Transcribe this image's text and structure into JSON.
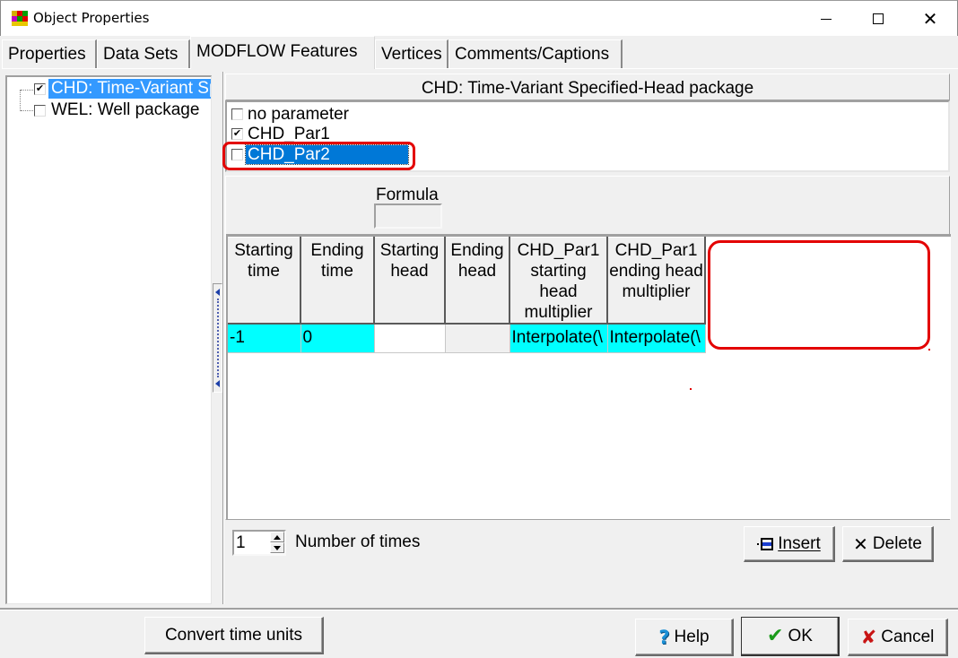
{
  "window": {
    "title": "Object Properties",
    "controls": {
      "minimize": "minimize",
      "maximize": "maximize",
      "close": "close"
    }
  },
  "tabs": [
    {
      "label": "Properties",
      "active": false
    },
    {
      "label": "Data Sets",
      "active": false
    },
    {
      "label": "MODFLOW Features",
      "active": true
    },
    {
      "label": "Vertices",
      "active": false
    },
    {
      "label": "Comments/Captions",
      "active": false
    }
  ],
  "tree": {
    "items": [
      {
        "label": "CHD: Time-Variant Specified-Head package",
        "checked": true,
        "selected": true
      },
      {
        "label": "WEL: Well package",
        "checked": false,
        "selected": false
      }
    ]
  },
  "package": {
    "header": "CHD: Time-Variant Specified-Head package",
    "parameters": [
      {
        "label": "no parameter",
        "checked": false,
        "selected": false
      },
      {
        "label": "CHD_Par1",
        "checked": true,
        "selected": false
      },
      {
        "label": "CHD_Par2",
        "checked": false,
        "selected": true
      }
    ]
  },
  "formula": {
    "label": "Formula",
    "value": ""
  },
  "grid": {
    "columns": [
      "Starting time",
      "Ending time",
      "Starting head",
      "Ending head",
      "CHD_Par1 starting head multiplier",
      "CHD_Par1 ending head multiplier"
    ],
    "rows": [
      [
        "-1",
        "0",
        "",
        "",
        "Interpolate(\\",
        "Interpolate(\\"
      ]
    ]
  },
  "number_of_times": {
    "label": "Number of times",
    "value": "1"
  },
  "buttons": {
    "insert": "Insert",
    "delete": "Delete",
    "convert": "Convert time units",
    "help": "Help",
    "ok": "OK",
    "cancel": "Cancel"
  },
  "icons": {
    "app": "modelmuse-app-icon",
    "insert": "insert-row-icon",
    "delete": "x-icon",
    "help": "question-mark-icon",
    "ok": "checkmark-icon",
    "cancel": "red-x-icon"
  },
  "colors": {
    "selection": "#0078d7",
    "tree_selection": "#3399ff",
    "cell_highlight": "#00ffff",
    "annotation_red": "#e30000"
  }
}
